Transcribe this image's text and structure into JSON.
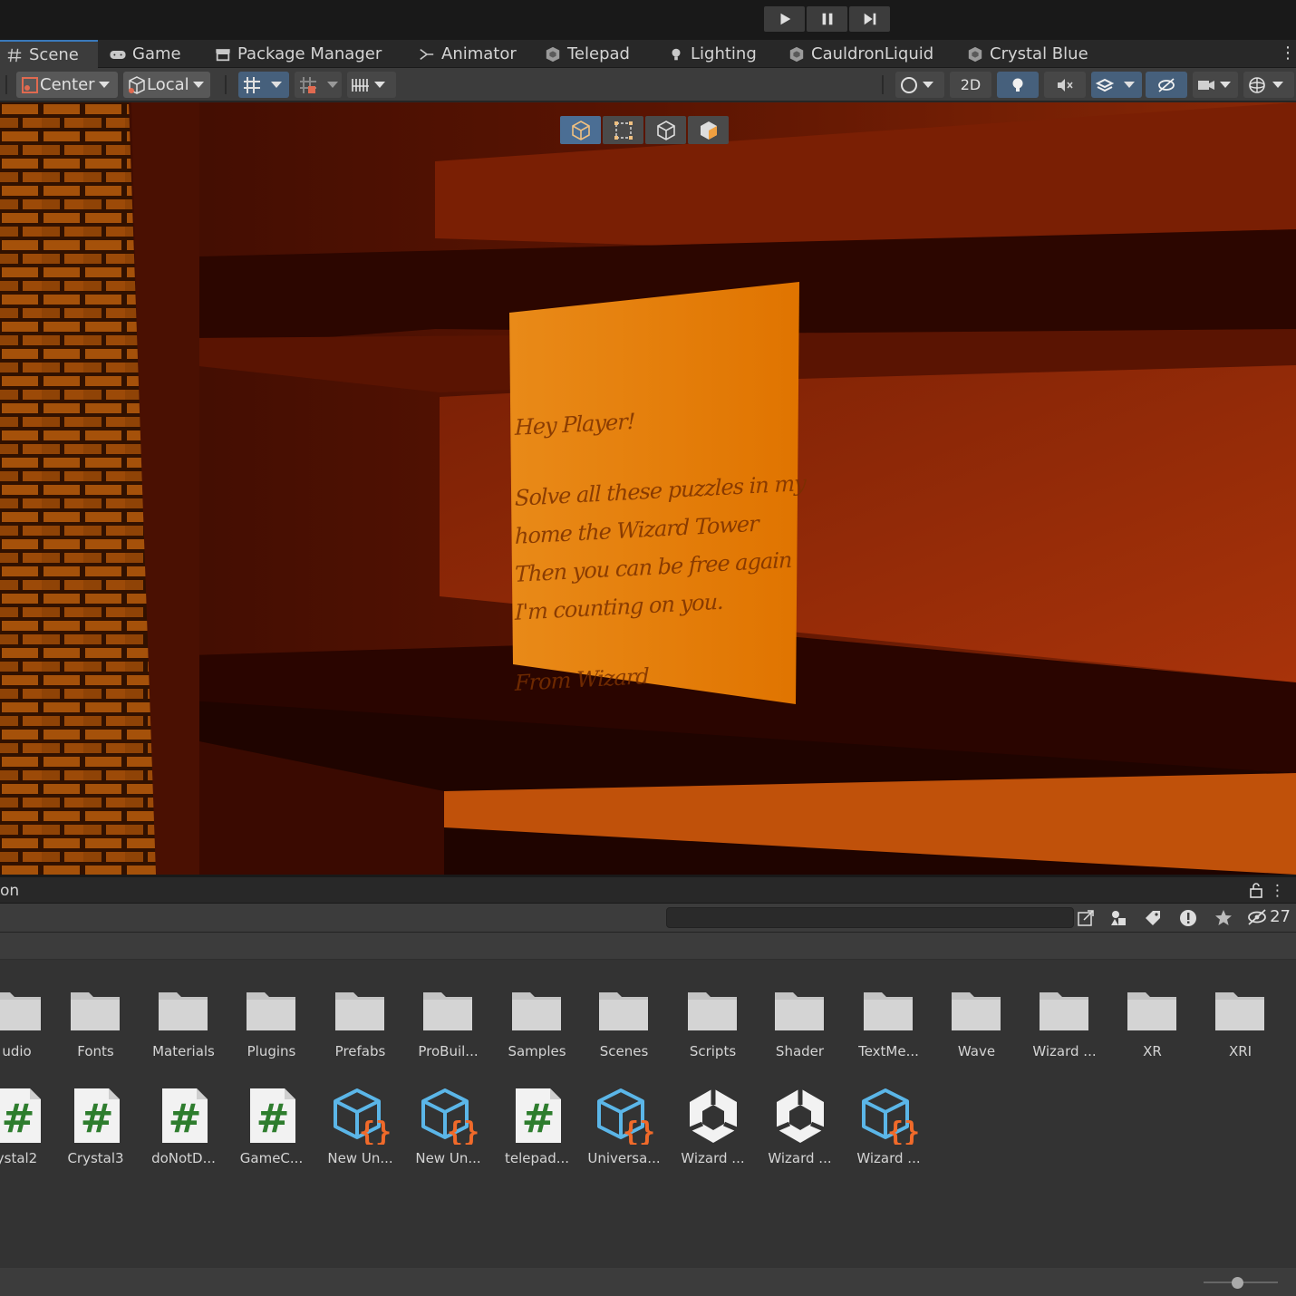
{
  "playbar": {
    "play_icon": "play-icon",
    "pause_icon": "pause-icon",
    "step_icon": "step-icon"
  },
  "tabs": [
    {
      "label": "Scene",
      "icon": "hash-icon",
      "active": true
    },
    {
      "label": "Game",
      "icon": "gamepad-icon"
    },
    {
      "label": "Package Manager",
      "icon": "package-icon"
    },
    {
      "label": "Animator",
      "icon": "animator-icon"
    },
    {
      "label": "Telepad",
      "icon": "prefab-icon"
    },
    {
      "label": "Lighting",
      "icon": "bulb-icon"
    },
    {
      "label": "CauldronLiquid",
      "icon": "prefab-icon"
    },
    {
      "label": "Crystal Blue",
      "icon": "prefab-icon"
    }
  ],
  "scene_toolbar": {
    "pivot_label": "Center",
    "space_label": "Local",
    "mode_2d_label": "2D"
  },
  "note": {
    "lines": [
      "Hey Player!",
      "",
      "Solve all these puzzles in my",
      "home the Wizard Tower",
      "Then you can be free again",
      "I'm counting on you.",
      "",
      "From Wizard"
    ]
  },
  "project": {
    "title": "on",
    "search_placeholder": "",
    "hidden_count": "27",
    "zoom_fraction": 0.45,
    "folders": [
      "udio",
      "Fonts",
      "Materials",
      "Plugins",
      "Prefabs",
      "ProBuil...",
      "Samples",
      "Scenes",
      "Scripts",
      "Shader",
      "TextMe...",
      "Wave",
      "Wizard ...",
      "XR",
      "XRI"
    ],
    "files": [
      {
        "label": "ystal2",
        "kind": "script"
      },
      {
        "label": "Crystal3",
        "kind": "script"
      },
      {
        "label": "doNotD...",
        "kind": "script"
      },
      {
        "label": "GameC...",
        "kind": "script"
      },
      {
        "label": "New Un...",
        "kind": "asset"
      },
      {
        "label": "New Un...",
        "kind": "asset"
      },
      {
        "label": "telepad...",
        "kind": "script"
      },
      {
        "label": "Universa...",
        "kind": "asset"
      },
      {
        "label": "Wizard ...",
        "kind": "unity"
      },
      {
        "label": "Wizard ...",
        "kind": "unity"
      },
      {
        "label": "Wizard ...",
        "kind": "asset"
      }
    ]
  },
  "colors": {
    "accent": "#3a79bb",
    "note_paper": "#e07a0c",
    "script_hash": "#2e7d2e",
    "asset_blue": "#5bb6e8",
    "asset_braces": "#f06a2a"
  }
}
